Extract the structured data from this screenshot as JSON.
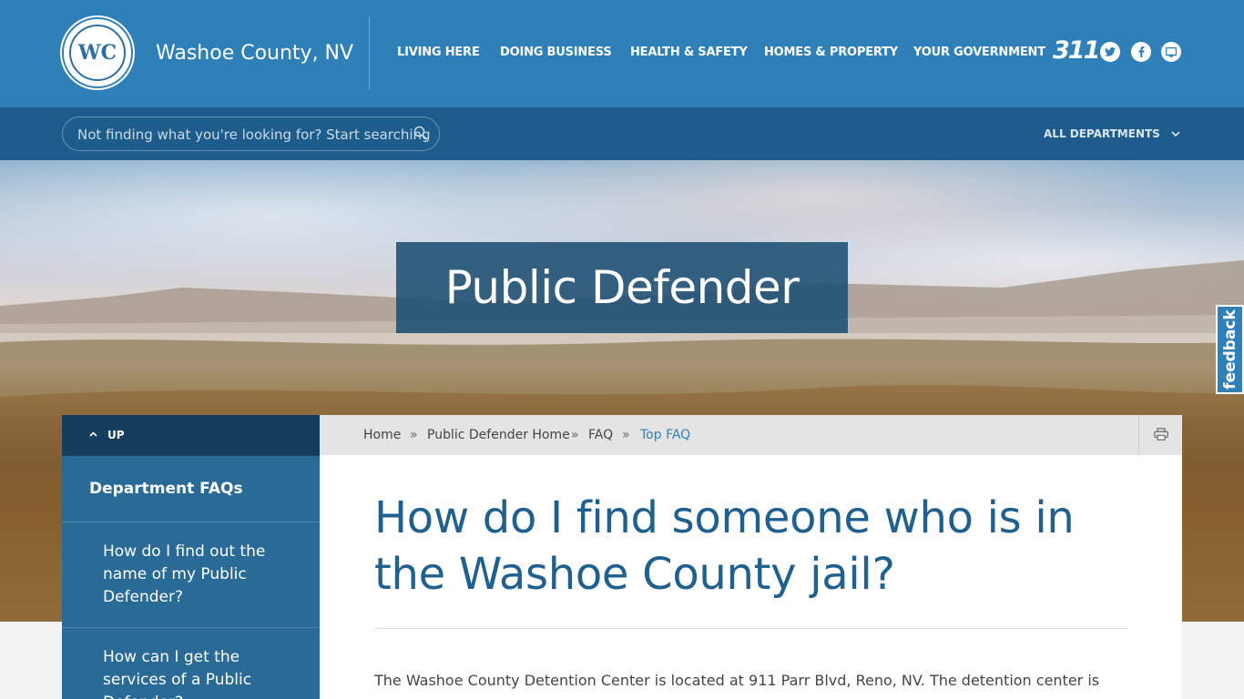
{
  "header": {
    "logo_text": "WC",
    "site_name": "Washoe County, NV",
    "nav": [
      "LIVING HERE",
      "DOING BUSINESS",
      "HEALTH & SAFETY",
      "HOMES & PROPERTY",
      "YOUR GOVERNMENT"
    ],
    "icon_311": "311",
    "social_icons": [
      "twitter-icon",
      "facebook-icon",
      "monitor-icon"
    ]
  },
  "search": {
    "placeholder": "Not finding what you're looking for? Start searching",
    "departments_label": "ALL DEPARTMENTS"
  },
  "hero": {
    "title": "Public Defender",
    "feedback_label": "feedback"
  },
  "sidebar": {
    "up_label": "UP",
    "heading": "Department FAQs",
    "items": [
      {
        "label": "How do I find out the name of my Public Defender?"
      },
      {
        "label": "How can I get the services of a Public Defender?"
      }
    ]
  },
  "breadcrumb": {
    "items": [
      "Home",
      "Public Defender Home",
      "FAQ",
      "Top FAQ"
    ],
    "separator": "»"
  },
  "content": {
    "title": "How do I find someone who is in the Washoe County jail?",
    "body": "The Washoe County Detention Center is located at 911 Parr Blvd, Reno, NV. The detention center is"
  },
  "colors": {
    "primary": "#2f7fb8",
    "dark": "#1e5d8b",
    "title": "#20608f"
  }
}
